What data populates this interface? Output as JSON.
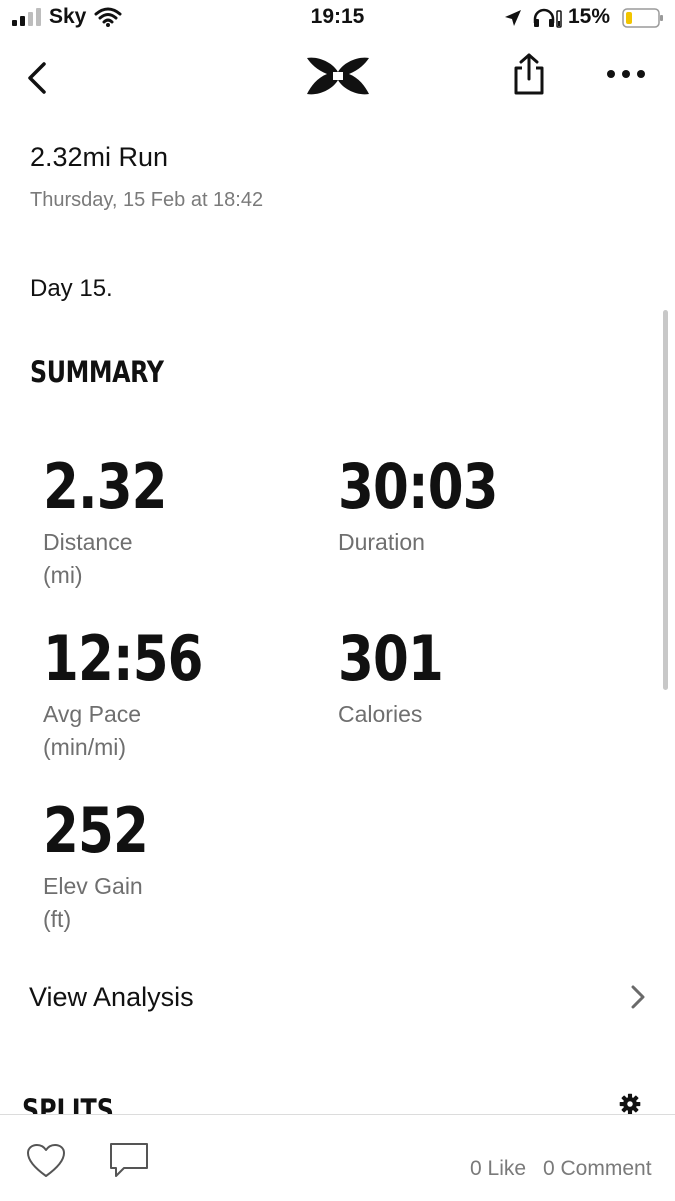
{
  "status_bar": {
    "carrier": "Sky",
    "time": "19:15",
    "battery": "15%"
  },
  "activity": {
    "title": "2.32mi Run",
    "date": "Thursday, 15 Feb at 18:42",
    "note": "Day 15."
  },
  "summary": {
    "heading": "SUMMARY",
    "stats": [
      {
        "value": "2.32",
        "label": "Distance",
        "unit": "(mi)"
      },
      {
        "value": "30:03",
        "label": "Duration",
        "unit": ""
      },
      {
        "value": "12:56",
        "label": "Avg Pace",
        "unit": "(min/mi)"
      },
      {
        "value": "301",
        "label": "Calories",
        "unit": ""
      },
      {
        "value": "252",
        "label": "Elev Gain",
        "unit": "(ft)"
      }
    ]
  },
  "view_analysis": {
    "label": "View Analysis"
  },
  "splits": {
    "heading": "SPLITS"
  },
  "social": {
    "likes": "0 Like",
    "comments": "0 Comment"
  },
  "icons": [
    "signal-icon",
    "wifi-icon",
    "location-icon",
    "headphones-icon",
    "battery-icon",
    "back-icon",
    "brand-logo",
    "share-icon",
    "more-icon",
    "chevron-right-icon",
    "settings-icon",
    "heart-icon",
    "comment-icon"
  ],
  "colors": {
    "battery_low": "#f2c500",
    "secondary_text": "#7a7a7a",
    "primary_text": "#111111"
  }
}
